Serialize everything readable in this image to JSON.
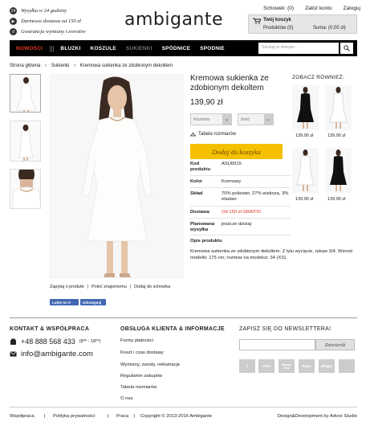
{
  "info": {
    "shipping_time": "Wysyłka w 24 godziny",
    "free_shipping": "Darmowa dostawa od 150 zł",
    "returns": "Gwarancja wymiany i zwrotów"
  },
  "logo": "ambigante",
  "top_links": {
    "wishlist": "Schowek: (0)",
    "create_account": "Załóż konto",
    "login": "Zaloguj"
  },
  "cart": {
    "title": "Twój koszyk",
    "products": "Produktów (0)",
    "sum": "Suma: (0,00 zł)"
  },
  "nav": {
    "items": [
      "NOWOŚCI",
      "BLUZKI",
      "KOSZULE",
      "SUKIENKI",
      "SPÓDNICE",
      "SPODNIE"
    ],
    "search_placeholder": "Szukaj w sklepie..."
  },
  "breadcrumb": [
    "Strona główna",
    "Sukienki",
    "Kremowa sukienka ze zdobionym dekoltem"
  ],
  "product": {
    "title": "Kremowa sukienka ze zdobionym dekoltem",
    "price": "139,90 zł",
    "size_label": "Rozmiar",
    "qty_label": "Ilość",
    "size_table": "Tabela rozmiarów",
    "add_to_cart": "Dodaj do koszyka",
    "specs": [
      {
        "key": "Kod produktu",
        "value": "ASU0015"
      },
      {
        "key": "Kolor",
        "value": "Kremowy"
      },
      {
        "key": "Skład",
        "value": "70% poliester, 27% wiskoza, 3% elastan"
      },
      {
        "key": "Dostawa",
        "value": "Od 150 zł GRATIS!"
      },
      {
        "key": "Planowana wysyłka",
        "value": "jeszcze dzisiaj"
      },
      {
        "key": "Opis produktu",
        "value": ""
      }
    ],
    "description": "Kremowa sukienka ze zdobionym dekoltem. Z tyłu wycięcie, rękaw 3/4. Wzrost modelki: 175 cm; rozmiar na modelce: 34 (XS).",
    "ask": "Zapytaj o produkt",
    "recommend": "Poleć znajomemu",
    "add_wishlist": "Dodaj do schowka",
    "fb_like": "Lubię to! 0",
    "fb_share": "Udostępnij"
  },
  "see_also": {
    "title": "ZOBACZ RÓWNIEŻ:",
    "prices": [
      "139,90 zł",
      "139,90 zł",
      "139,90 zł",
      "139,90 zł"
    ]
  },
  "footer": {
    "contact_title": "KONTAKT & WSPÓŁPRACA",
    "phone": "+48 888 568 433",
    "hours": "(8⁰⁰ - 18⁰⁰)",
    "email": "info@ambigante.com",
    "service_title": "OBSŁUGA KLIENTA & INFORMACJE",
    "service_links": [
      "Formy płatności",
      "Koszt i czas dostawy",
      "Wymiany, zwroty, reklamacje",
      "Regulamin zakupów",
      "Tabela rozmiarów",
      "O nas"
    ],
    "newsletter_title": "ZAPISZ SIĘ DO NEWSLETTERA!",
    "newsletter_button": "Zatwierdź",
    "payments": [
      "f",
      "VISA",
      "Master Card",
      "PayU",
      "allegro",
      ""
    ]
  },
  "bottom": {
    "links": [
      "Współpraca",
      "Polityka prywatności",
      "Praca"
    ],
    "copyright": "Copyright © 2013-2016 Ambigante",
    "credit": "Design&Development by Advox Studio"
  }
}
